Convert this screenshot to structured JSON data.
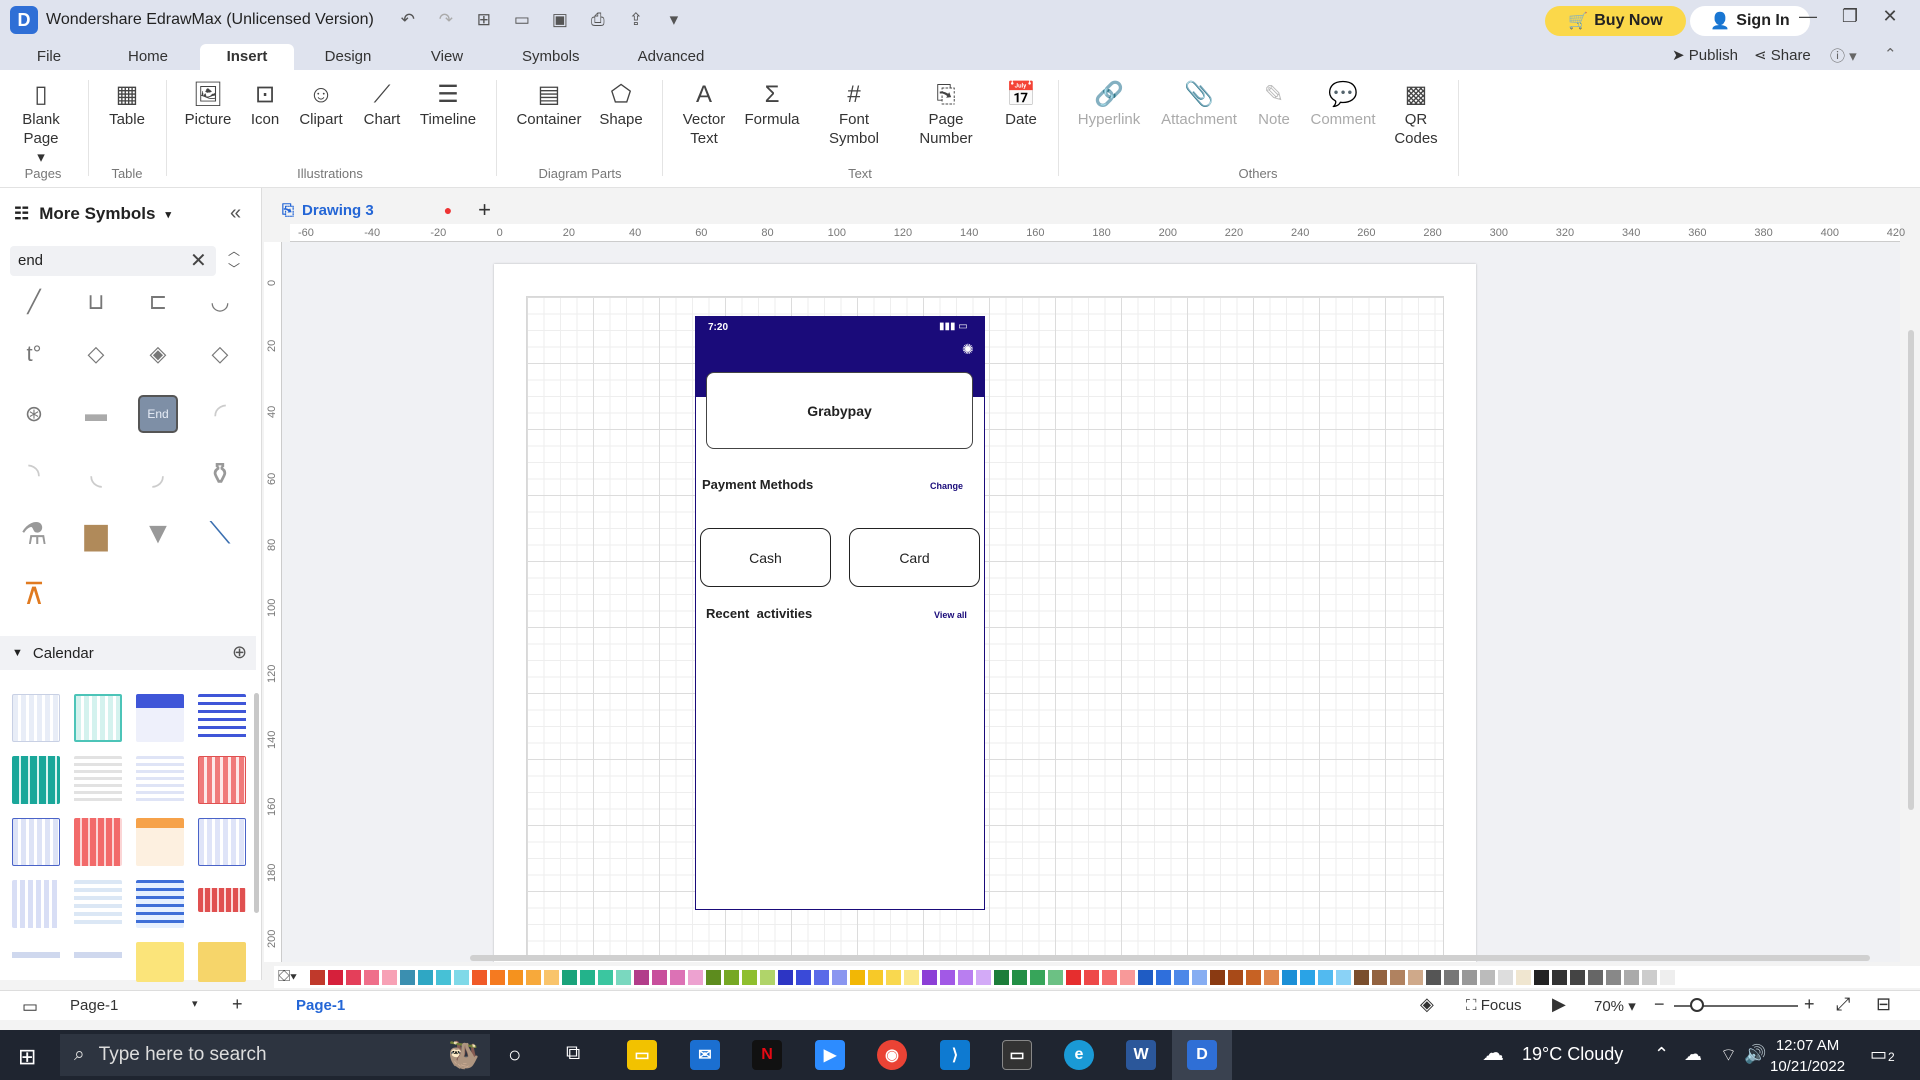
{
  "window": {
    "title": "Wondershare EdrawMax (Unlicensed Version)",
    "buy_label": "Buy Now",
    "signin_label": "Sign In"
  },
  "menu": {
    "tabs": [
      "File",
      "Home",
      "Insert",
      "Design",
      "View",
      "Symbols",
      "Advanced"
    ],
    "active": "Insert",
    "publish_label": "Publish",
    "share_label": "Share"
  },
  "ribbon": {
    "pages": {
      "blank_page": "Blank\nPage",
      "group": "Pages"
    },
    "table": {
      "label": "Table",
      "group": "Table"
    },
    "illustrations": {
      "picture": "Picture",
      "icon": "Icon",
      "clipart": "Clipart",
      "chart": "Chart",
      "timeline": "Timeline",
      "group": "Illustrations"
    },
    "diagram_parts": {
      "container": "Container",
      "shape": "Shape",
      "group": "Diagram Parts"
    },
    "text": {
      "vector_text": "Vector\nText",
      "formula": "Formula",
      "font_symbol": "Font\nSymbol",
      "page_number": "Page\nNumber",
      "date": "Date",
      "group": "Text"
    },
    "others": {
      "hyperlink": "Hyperlink",
      "attachment": "Attachment",
      "note": "Note",
      "comment": "Comment",
      "qr_codes": "QR\nCodes",
      "group": "Others"
    }
  },
  "left_panel": {
    "title": "More Symbols",
    "search_value": "end",
    "end_symbol_text": "End",
    "calendar_label": "Calendar"
  },
  "document": {
    "tab_name": "Drawing 3",
    "hruler_ticks": [
      "-60",
      "-40",
      "-20",
      "0",
      "20",
      "40",
      "60",
      "80",
      "100",
      "120",
      "140",
      "160",
      "180",
      "200",
      "220",
      "240",
      "260",
      "280",
      "300",
      "320",
      "340",
      "360",
      "380",
      "400",
      "420"
    ],
    "vruler_ticks": [
      "0",
      "20",
      "40",
      "60",
      "80",
      "100",
      "120",
      "140",
      "160",
      "180",
      "200"
    ]
  },
  "phone": {
    "time": "7:20",
    "app_name": "Grabypay",
    "payment_methods": "Payment Methods",
    "change": "Change",
    "cash": "Cash",
    "card": "Card",
    "recent_activities": "Recent  activities",
    "view_all": "View all"
  },
  "palette": [
    "#c0392b",
    "#d6203b",
    "#e43f5a",
    "#ef6f8a",
    "#f7a1b5",
    "#3b8fb0",
    "#2fa7c4",
    "#47c1d6",
    "#7fd9e8",
    "#f05a28",
    "#f57a20",
    "#f5921e",
    "#f7a93b",
    "#f9c46b",
    "#1aa37a",
    "#23b38b",
    "#3bc6a0",
    "#7ad8bf",
    "#b23d8a",
    "#c84f9c",
    "#dc72b5",
    "#eda2d0",
    "#5d8c1e",
    "#76a823",
    "#8fbf2f",
    "#b0d46a",
    "#2d35c4",
    "#3a4ad8",
    "#5a6ae8",
    "#8a96f0",
    "#f2b705",
    "#f7c928",
    "#f9d84f",
    "#fbe88a",
    "#8c3fd6",
    "#a259e6",
    "#b97ef0",
    "#d3aaf7",
    "#1c7d3a",
    "#238f45",
    "#37a55a",
    "#6cc184",
    "#e62e2e",
    "#ee4848",
    "#f46a6a",
    "#f89999",
    "#1f5cc4",
    "#2f6fdc",
    "#4d88e8",
    "#86adf2",
    "#8a3a12",
    "#a84a18",
    "#c76224",
    "#e0874d",
    "#1b8fd6",
    "#2aa3e6",
    "#52baf0",
    "#8ad2f6",
    "#7a4e2d",
    "#936340",
    "#b08260",
    "#cfa98a",
    "#555555",
    "#777777",
    "#999999",
    "#bbbbbb",
    "#dddddd",
    "#f0e6d0",
    "#222222",
    "#333333",
    "#444444",
    "#666666",
    "#888888",
    "#aaaaaa",
    "#cccccc",
    "#eeeeee"
  ],
  "status": {
    "page_select": "Page-1",
    "page_tab": "Page-1",
    "focus_label": "Focus",
    "zoom": "70%"
  },
  "taskbar": {
    "search_placeholder": "Type here to search",
    "weather": "19°C  Cloudy",
    "time": "12:07 AM",
    "date": "10/21/2022",
    "notifications": "2"
  }
}
